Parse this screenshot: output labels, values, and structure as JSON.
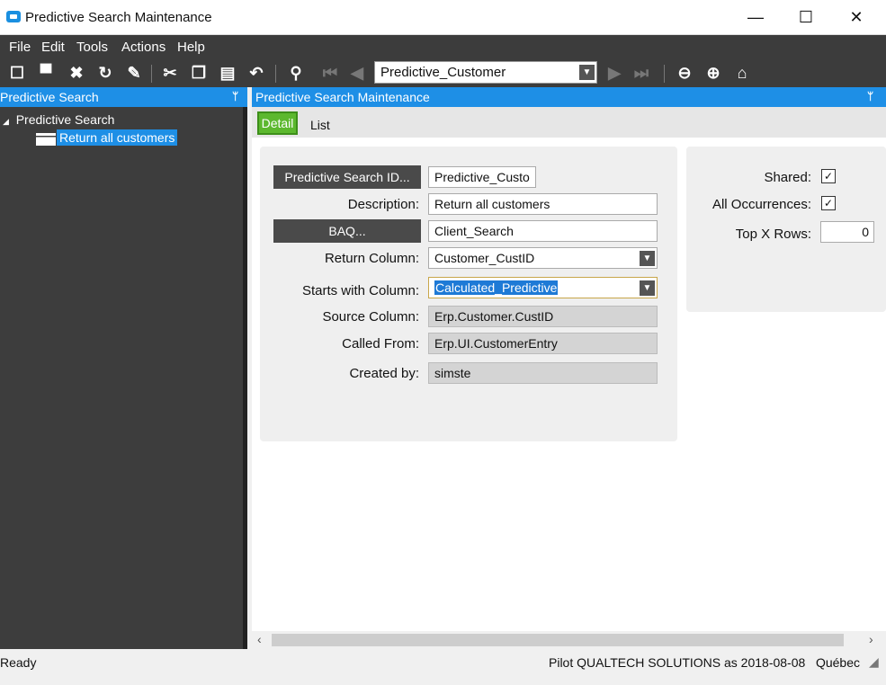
{
  "window": {
    "title": "Predictive Search Maintenance",
    "minimize": "—",
    "maximize": "☐",
    "close": "✕"
  },
  "menu": [
    "File",
    "Edit",
    "Tools",
    "Actions",
    "Help"
  ],
  "toolbar": {
    "nav_value": "Predictive_Customer"
  },
  "left_panel": {
    "header": "Predictive Search",
    "tree_root": "Predictive Search",
    "tree_item": "Return all customers"
  },
  "right_panel": {
    "header": "Predictive Search Maintenance"
  },
  "tabs": {
    "detail": "Detail",
    "list": "List"
  },
  "form": {
    "search_id_btn": "Predictive Search ID...",
    "search_id_value": "Predictive_Custo",
    "description_label": "Description:",
    "description_value": "Return all customers",
    "baq_btn": "BAQ...",
    "baq_value": "Client_Search",
    "return_column_label": "Return Column:",
    "return_column_value": "Customer_CustID",
    "starts_with_label": "Starts with Column:",
    "starts_with_value": "Calculated_Predictive",
    "source_column_label": "Source Column:",
    "source_column_value": "Erp.Customer.CustID",
    "called_from_label": "Called From:",
    "called_from_value": "Erp.UI.CustomerEntry",
    "created_by_label": "Created by:",
    "created_by_value": "simste"
  },
  "side": {
    "shared_label": "Shared:",
    "shared_checked": true,
    "all_occurrences_label": "All Occurrences:",
    "all_occurrences_checked": true,
    "top_x_label": "Top X Rows:",
    "top_x_value": "0"
  },
  "status": {
    "left": "Ready",
    "right": "Pilot QUALTECH SOLUTIONS as 2018-08-08   Québec"
  },
  "colors": {
    "accent": "#1e8fe6",
    "tab_active": "#5cb82e",
    "dark": "#3c3c3c"
  }
}
